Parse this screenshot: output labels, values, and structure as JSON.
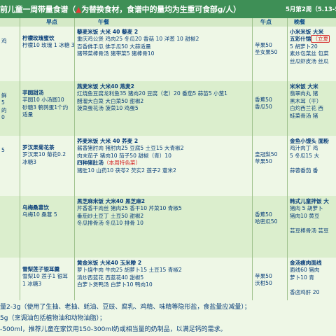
{
  "header": {
    "title_a": "前儿童一周带量食谱（",
    "title_tri": "▲",
    "title_b": "为替换食材，食谱中的量均为生重可食部g/人）",
    "date": "5月第2周（5.13-5"
  },
  "columns": {
    "morning": "早点",
    "lunch": "午餐",
    "afternoon": "午点",
    "dinner": "晚餐"
  },
  "rows": [
    {
      "left": [
        "鸡"
      ],
      "morning": [
        "柠檬玫瑰蜜饮",
        "柠檬10 玫瑰 1 冰糖 3"
      ],
      "lunch": [
        "藜麦米饭 大米 40 藜麦 2",
        "重庆鸡公煲 鸡肉25 冬瓜20 香菇 10 洋葱 10 甜椒2",
        "百香佛手瓜 佛手瓜50 大蒜适量",
        "猪带菜棒骨汤 猪带菜5 猪棒骨10"
      ],
      "afternoon": [
        "苹果50",
        "圣女果50"
      ],
      "dinner": [
        "小米米饭 大米",
        "五彩什锦（立夏",
        "5 胡萝卜20",
        "素炒包菜丝 包菜",
        "丝瓜虾皮汤 丝瓜"
      ]
    },
    {
      "left": [
        "鲜",
        "5",
        "的",
        "0"
      ],
      "morning": [
        "芋圆甜汤",
        "芋圆10 小汤圆10",
        "砂糖3 鹌鹑蛋1个约",
        "适量"
      ],
      "lunch": [
        "燕麦米饭 大米40 燕麦2",
        "红烧鱼豆腐龙利鱼35 猪肉20 豆腐（老）20 番茄5 蒜苗5 小葱1",
        "醋溜大白菜 大白菜50 甜椒2",
        "菠菜蛋花汤 菠菜10 鸡蛋5"
      ],
      "afternoon": [
        "香蕉50",
        "香瓜50"
      ],
      "dinner": [
        "米米饭 大米",
        "翡翠肉丸 猪",
        "黑木耳（干）",
        "白灼西兰花 西",
        "蛙菜骨汤 猪"
      ]
    },
    {
      "left": [
        "5"
      ],
      "morning": [
        "罗汉果菊花茶",
        "罗汉果10 菊花0.2",
        "冰糖3"
      ],
      "lunch": [
        "荞麦米饭 大米 40 荞麦 2",
        "酱香猪肘肉 猪肘肉25 豆腐5 土豆15 大青椒2",
        "肉末茄子 猪肉10 茄子50 甜椒（青）10",
        "四种猪肚汤（本周特色菜）",
        "猪肚10 山药10 茯苓2 芡实2 莲子2 薏米2"
      ],
      "afternoon": [
        "皇冠梨50",
        "苹果50"
      ],
      "dinner": [
        "金鱼小馒头 面粉",
        "鸡汁肉丁 鸡",
        "5 冬瓜15 大",
        "",
        "蒜蓉番茄 番"
      ]
    },
    {
      "left": [],
      "morning": [
        "乌梅桑葚饮",
        "乌梅10 桑葚 5"
      ],
      "lunch": [
        "黑芝麻米饭 大米40 黑芝麻2",
        "芹香香干肉丝 猪肉25 香干10 芹菜10 青椒5",
        "番茄炒土豆丁 土豆50 甜椒2",
        "冬瓜排骨汤 冬瓜10 排骨 10"
      ],
      "afternoon": [
        "香蕉50",
        "哈密瓜50"
      ],
      "dinner": [
        "韩式儿童拌饭 大",
        "猪肉 5 胡萝卜",
        "猪肉10 黄豆",
        "",
        "芸豆棒骨汤 芸豆"
      ]
    },
    {
      "left": [],
      "morning": [
        "雪梨莲子银耳羹",
        "雪梨10 莲子1 银耳",
        "1 冰糖3"
      ],
      "lunch": [
        "黄金米饭 大米40 玉米糁 2",
        "萝卜烧牛肉 牛肉25 胡萝卜15 土豆15 青椒2",
        "清炒西蓝花 西蓝花40 甜椒5",
        "白萝卜煲鸭汤 白萝卜10 鸭肉10"
      ],
      "afternoon": [
        "苹果50",
        "沃柑50"
      ],
      "dinner": [
        "金汤瘦肉面线",
        "面线60 猪肉",
        "萝卜10 青",
        "",
        "香卤鸡肝 20"
      ]
    }
  ],
  "footer": {
    "line1": "量2-3g（使用了生抽、老抽、蚝油、豆豉、腐乳、鸡精、味精等隐形盐，食盐量应减量）；",
    "line2": "5g（烹调油包括植物油和动物油脂）；",
    "line3": "-500ml，推荐儿童在家饮用150-300ml奶或相当量的奶制品，以满足钙的需求。"
  }
}
